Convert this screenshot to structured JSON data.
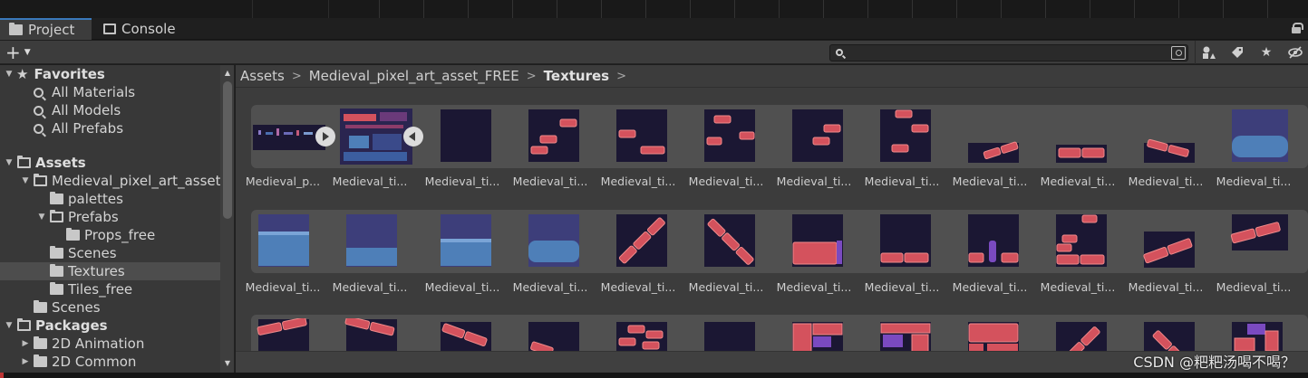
{
  "tabs": [
    {
      "label": "Project",
      "icon": "folder-icon",
      "active": true
    },
    {
      "label": "Console",
      "icon": "console-icon",
      "active": false
    }
  ],
  "toolbar": {
    "add_label": "+",
    "search_placeholder": "",
    "icons": [
      "search-by-type-icon",
      "label-tag-icon",
      "favorite-star-icon",
      "hidden-packages-icon"
    ]
  },
  "tree": {
    "items": [
      {
        "label": "Favorites",
        "kind": "star",
        "bold": true,
        "arrow": "▼",
        "indent": 0
      },
      {
        "label": "All Materials",
        "kind": "search",
        "indent": 1
      },
      {
        "label": "All Models",
        "kind": "search",
        "indent": 1
      },
      {
        "label": "All Prefabs",
        "kind": "search",
        "indent": 1
      },
      {
        "label": "Assets",
        "kind": "folder-open",
        "bold": true,
        "arrow": "▼",
        "indent": 0
      },
      {
        "label": "Medieval_pixel_art_asset_FREE",
        "kind": "folder-open",
        "arrow": "▼",
        "indent": 1
      },
      {
        "label": "palettes",
        "kind": "folder",
        "indent": 2
      },
      {
        "label": "Prefabs",
        "kind": "folder-open",
        "arrow": "▼",
        "indent": 2
      },
      {
        "label": "Props_free",
        "kind": "folder",
        "indent": 3
      },
      {
        "label": "Scenes",
        "kind": "folder",
        "indent": 2
      },
      {
        "label": "Textures",
        "kind": "folder",
        "indent": 2,
        "selected": true
      },
      {
        "label": "Tiles_free",
        "kind": "folder",
        "indent": 2
      },
      {
        "label": "Scenes",
        "kind": "folder",
        "indent": 1
      },
      {
        "label": "Packages",
        "kind": "folder-open",
        "bold": true,
        "arrow": "▼",
        "indent": 0
      },
      {
        "label": "2D Animation",
        "kind": "folder",
        "arrow": "▶",
        "indent": 1
      },
      {
        "label": "2D Common",
        "kind": "folder",
        "arrow": "▶",
        "indent": 1
      }
    ]
  },
  "breadcrumb": [
    "Assets",
    "Medieval_pixel_art_asset_FREE",
    "Textures"
  ],
  "grid": {
    "row1_labels": [
      "Medieval_p...",
      "Medieval_ti...",
      "Medieval_ti...",
      "Medieval_ti...",
      "Medieval_ti...",
      "Medieval_ti...",
      "Medieval_ti...",
      "Medieval_ti...",
      "Medieval_ti...",
      "Medieval_ti...",
      "Medieval_ti...",
      "Medieval_ti..."
    ],
    "row2_labels": [
      "Medieval_ti...",
      "Medieval_ti...",
      "Medieval_ti...",
      "Medieval_ti...",
      "Medieval_ti...",
      "Medieval_ti...",
      "Medieval_ti...",
      "Medieval_ti...",
      "Medieval_ti...",
      "Medieval_ti...",
      "Medieval_ti...",
      "Medieval_ti..."
    ]
  },
  "colors": {
    "tile_dark": "#1b1733",
    "brick": "#d4525d",
    "brick_light": "#f08a8a",
    "water": "#4e7fb8",
    "stone_purple": "#3d3e7a",
    "accent": "#3a79bb"
  },
  "watermark": "CSDN @粑粑汤喝不喝？"
}
